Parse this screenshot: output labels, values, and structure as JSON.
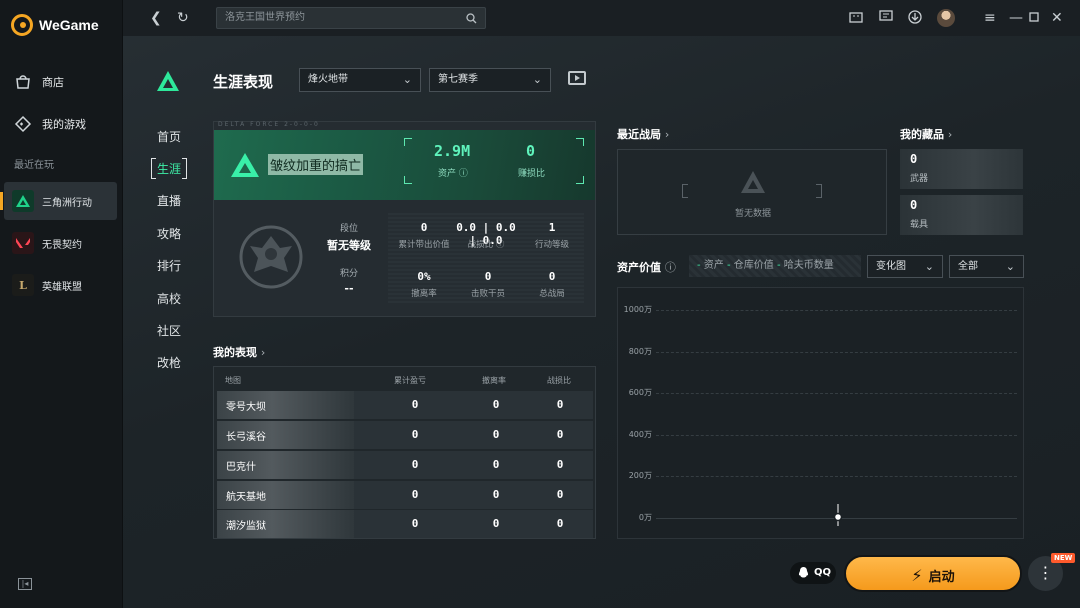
{
  "app": {
    "logo_text": "WeGame"
  },
  "sidebar": {
    "nav": [
      {
        "label": "商店",
        "icon": "store-icon"
      },
      {
        "label": "我的游戏",
        "icon": "gamepad-icon"
      }
    ],
    "recent_heading": "最近在玩",
    "games": [
      {
        "label": "三角洲行动",
        "color": "#1fd38a"
      },
      {
        "label": "无畏契约",
        "color": "#ff4655"
      },
      {
        "label": "英雄联盟",
        "color": "#c8aa6e"
      }
    ]
  },
  "topbar": {
    "search_placeholder": "洛克王国世界预约"
  },
  "section_nav": [
    "首页",
    "生涯",
    "直播",
    "攻略",
    "排行",
    "高校",
    "社区",
    "改枪"
  ],
  "page": {
    "title": "生涯表现",
    "mode_select": "烽火地带",
    "season_select": "第七赛季"
  },
  "profile": {
    "tag": "DELTA FORCE 2-0-0-0",
    "player_name": "皱纹加重的搞亡",
    "assets_value": "2.9M",
    "assets_label": "资产",
    "kd_value": "0",
    "kd_label": "赚损比",
    "rank_label": "段位",
    "rank_value": "暂无等级",
    "points_label": "积分",
    "points_value": "--",
    "stats": [
      {
        "value": "0",
        "label": "累计带出价值"
      },
      {
        "value": "0.0 | 0.0 | 0.0",
        "label": "战损比"
      },
      {
        "value": "1",
        "label": "行动等级"
      },
      {
        "value": "0%",
        "label": "撤离率"
      },
      {
        "value": "0",
        "label": "击败干员"
      },
      {
        "value": "0",
        "label": "总战局"
      }
    ]
  },
  "performance": {
    "heading": "我的表现",
    "columns": [
      "地图",
      "累计盈亏",
      "撤离率",
      "战损比"
    ],
    "rows": [
      {
        "map": "零号大坝",
        "profit": "0",
        "extract": "0",
        "kd": "0"
      },
      {
        "map": "长弓溪谷",
        "profit": "0",
        "extract": "0",
        "kd": "0"
      },
      {
        "map": "巴克什",
        "profit": "0",
        "extract": "0",
        "kd": "0"
      },
      {
        "map": "航天基地",
        "profit": "0",
        "extract": "0",
        "kd": "0"
      },
      {
        "map": "潮汐监狱",
        "profit": "0",
        "extract": "0",
        "kd": "0"
      }
    ]
  },
  "recent_matches": {
    "heading": "最近战局",
    "empty": "暂无数据"
  },
  "collection": {
    "heading": "我的藏品",
    "items": [
      {
        "value": "0",
        "label": "武器"
      },
      {
        "value": "0",
        "label": "载具"
      }
    ]
  },
  "asset_value": {
    "heading": "资产价值",
    "legend": [
      "资产",
      "仓库价值",
      "哈夫币数量"
    ],
    "view_select": "变化图",
    "filter_select": "全部",
    "y_ticks": [
      "1000万",
      "800万",
      "600万",
      "400万",
      "200万",
      "0万"
    ]
  },
  "bottom": {
    "qq_label": "QQ",
    "launch_label": "启动",
    "new_badge": "NEW"
  }
}
